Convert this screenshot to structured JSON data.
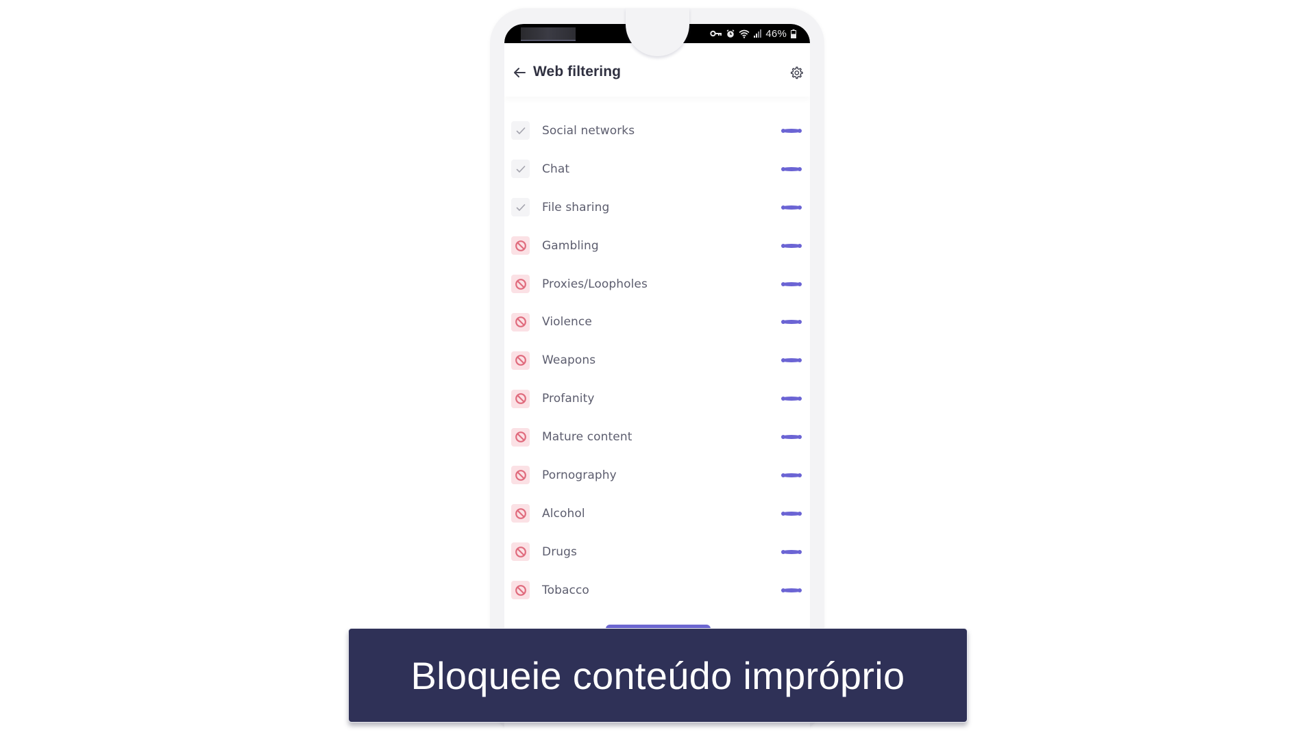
{
  "status_bar": {
    "icons": [
      "vpn-key-icon",
      "alarm-icon",
      "wifi-icon",
      "signal-icon",
      "battery-icon"
    ],
    "battery_percent": "46%"
  },
  "header": {
    "back_icon": "arrow-left-icon",
    "title": "Web filtering",
    "settings_icon": "gear-icon"
  },
  "categories": [
    {
      "label": "Social networks",
      "status": "allowed",
      "status_icon": "check-icon"
    },
    {
      "label": "Chat",
      "status": "allowed",
      "status_icon": "check-icon"
    },
    {
      "label": "File sharing",
      "status": "allowed",
      "status_icon": "check-icon"
    },
    {
      "label": "Gambling",
      "status": "blocked",
      "status_icon": "block-icon"
    },
    {
      "label": "Proxies/Loopholes",
      "status": "blocked",
      "status_icon": "block-icon"
    },
    {
      "label": "Violence",
      "status": "blocked",
      "status_icon": "block-icon"
    },
    {
      "label": "Weapons",
      "status": "blocked",
      "status_icon": "block-icon"
    },
    {
      "label": "Profanity",
      "status": "blocked",
      "status_icon": "block-icon"
    },
    {
      "label": "Mature content",
      "status": "blocked",
      "status_icon": "block-icon"
    },
    {
      "label": "Pornography",
      "status": "blocked",
      "status_icon": "block-icon"
    },
    {
      "label": "Alcohol",
      "status": "blocked",
      "status_icon": "block-icon"
    },
    {
      "label": "Drugs",
      "status": "blocked",
      "status_icon": "block-icon"
    },
    {
      "label": "Tobacco",
      "status": "blocked",
      "status_icon": "block-icon"
    }
  ],
  "row_action_icon": "more-horizontal-icon",
  "colors": {
    "accent": "#6b64d4",
    "blocked": "#e06b7d",
    "blocked_bg": "#fbe1e5",
    "allowed": "#9a9aa4",
    "caption_bg": "#2f3157"
  },
  "caption": {
    "text": "Bloqueie conteúdo impróprio"
  }
}
